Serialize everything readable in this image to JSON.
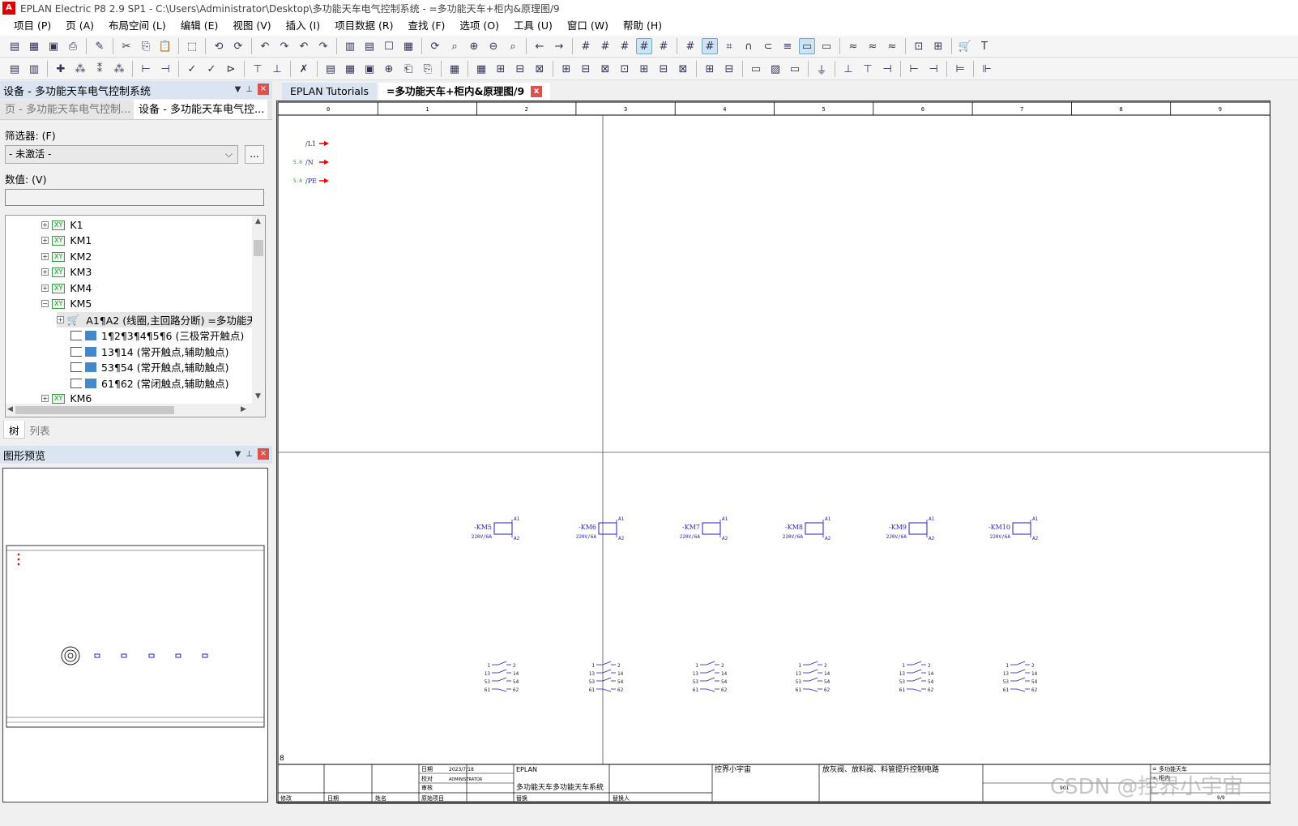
{
  "window": {
    "title": "EPLAN Electric P8 2.9 SP1 - C:\\Users\\Administrator\\Desktop\\多功能天车电气控制系统 - =多功能天车+柜内&原理图/9"
  },
  "menu": [
    "项目 (P)",
    "页 (A)",
    "布局空间 (L)",
    "编辑 (E)",
    "视图 (V)",
    "插入 (I)",
    "项目数据 (R)",
    "查找 (F)",
    "选项 (O)",
    "工具 (U)",
    "窗口 (W)",
    "帮助 (H)"
  ],
  "device_panel": {
    "title": "设备 - 多功能天车电气控制系统",
    "tabs": [
      "页 - 多功能天车电气控制...",
      "设备 - 多功能天车电气控..."
    ],
    "filter_label": "筛选器: (F)",
    "filter_value": "- 未激活 -",
    "filter_more": "...",
    "value_label": "数值: (V)",
    "tree": [
      {
        "label": "K1",
        "expander": "+"
      },
      {
        "label": "KM1",
        "expander": "+"
      },
      {
        "label": "KM2",
        "expander": "+"
      },
      {
        "label": "KM3",
        "expander": "+"
      },
      {
        "label": "KM4",
        "expander": "+"
      },
      {
        "label": "KM5",
        "expander": "−"
      }
    ],
    "km5_children": [
      "A1¶A2 (线圈,主回路分断) =多功能天",
      "1¶2¶3¶4¶5¶6 (三极常开触点)",
      "13¶14 (常开触点,辅助触点)",
      "53¶54 (常开触点,辅助触点)",
      "61¶62 (常闭触点,辅助触点)"
    ],
    "tree_last": "KM6",
    "bottom_tabs": [
      "树",
      "列表"
    ]
  },
  "preview_panel": {
    "title": "图形预览"
  },
  "doc_tabs": [
    "EPLAN Tutorials",
    "=多功能天车+柜内&原理图/9",
    "x"
  ],
  "schematic": {
    "columns": [
      "0",
      "1",
      "2",
      "3",
      "4",
      "5",
      "6",
      "7",
      "8",
      "9"
    ],
    "potentials": [
      {
        "prefix": "",
        "name": "/L1"
      },
      {
        "prefix": "5.0",
        "name": "/N"
      },
      {
        "prefix": "5.0",
        "name": "/PE"
      }
    ],
    "coils": [
      {
        "name": "-KM5",
        "rating": "220V/6A"
      },
      {
        "name": "-KM6",
        "rating": "220V/6A"
      },
      {
        "name": "-KM7",
        "rating": "220V/6A"
      },
      {
        "name": "-KM8",
        "rating": "220V/6A"
      },
      {
        "name": "-KM9",
        "rating": "220V/6A"
      },
      {
        "name": "-KM10",
        "rating": "220V/6A"
      }
    ],
    "coil_terms": [
      "A1",
      "A2"
    ],
    "contact_rows": [
      [
        "1",
        "2"
      ],
      [
        "13",
        "14"
      ],
      [
        "53",
        "54"
      ],
      [
        "61",
        "62"
      ]
    ],
    "row_label": "8",
    "title_block": {
      "date_label": "日期",
      "date": "2023/7/18",
      "check_label": "校对",
      "user": "ADMINISTRATOR",
      "review_label": "审核",
      "company": "EPLAN",
      "project": "多功能天车多功能天车系统",
      "author": "控界小宇宙",
      "description": "放灰阀、放料阀、料管提升控制电路",
      "right1": "= 多功能天车",
      "right2": "+ 柜内",
      "page": "9/9",
      "num": "901",
      "mod_label": "修改",
      "date2_label": "日期",
      "name_label": "姓名",
      "orig_label": "原始项目",
      "replace_label": "替换",
      "replaced_label": "替换人"
    }
  },
  "watermark": "CSDN @控界小宇宙"
}
